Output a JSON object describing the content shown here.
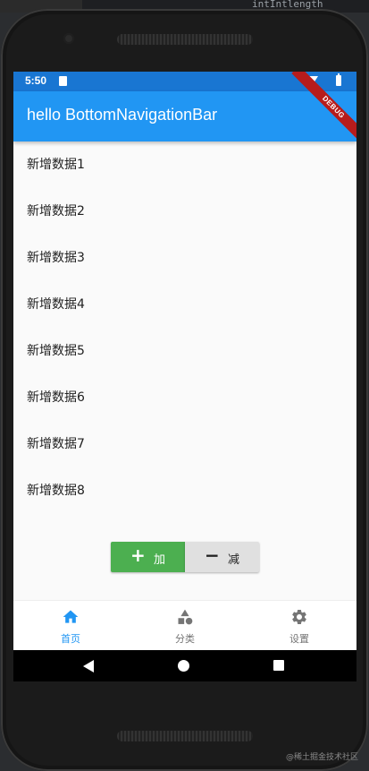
{
  "editor": {
    "snippet": "intIntlength"
  },
  "status_bar": {
    "time": "5:50"
  },
  "app_bar": {
    "title": "hello BottomNavigationBar",
    "debug_banner": "DEBUG"
  },
  "list": {
    "items": [
      "新增数据1",
      "新增数据2",
      "新增数据3",
      "新增数据4",
      "新增数据5",
      "新增数据6",
      "新增数据7",
      "新增数据8"
    ]
  },
  "buttons": {
    "add_glyph": "+",
    "add_label": "加",
    "subtract_glyph": "−",
    "subtract_label": "减"
  },
  "bottom_nav": {
    "items": [
      {
        "label": "首页",
        "icon": "home-icon",
        "active": true
      },
      {
        "label": "分类",
        "icon": "category-icon",
        "active": false
      },
      {
        "label": "设置",
        "icon": "settings-icon",
        "active": false
      }
    ]
  },
  "colors": {
    "status_bar": "#1976d2",
    "app_bar": "#2196f3",
    "add_button": "#4caf50",
    "subtract_button": "#e0e0e0",
    "active_nav": "#2196f3",
    "inactive_nav": "#757575"
  },
  "watermark": "@稀土掘金技术社区"
}
